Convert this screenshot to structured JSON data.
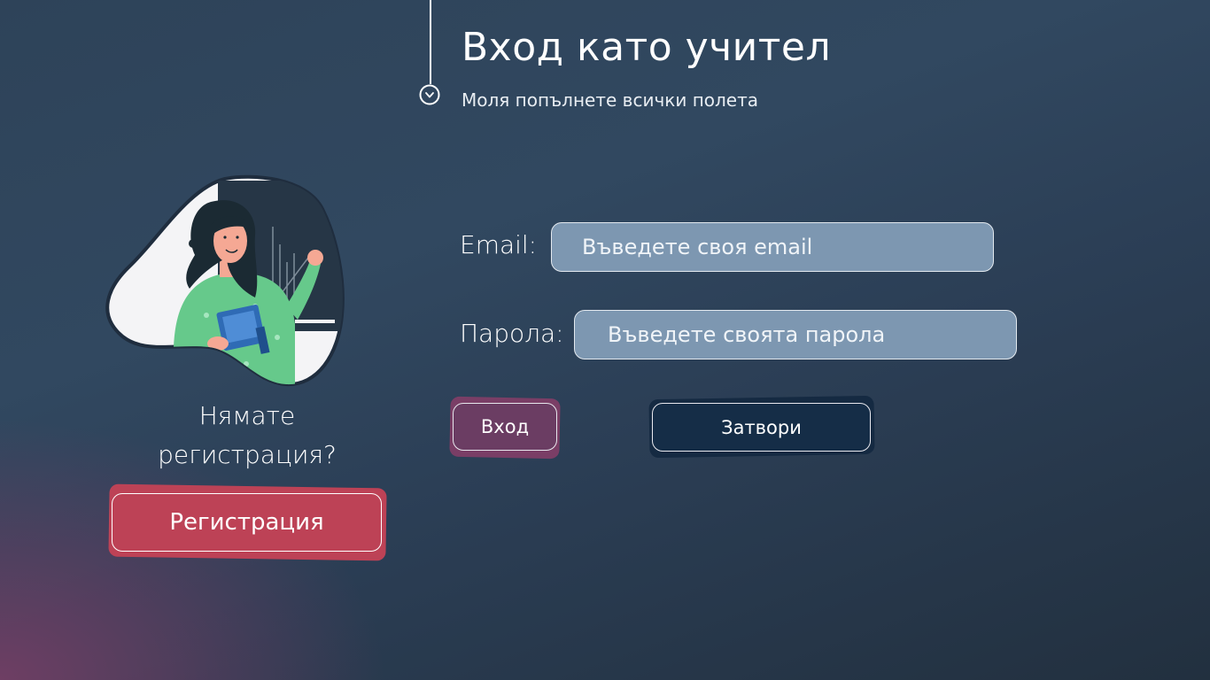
{
  "header": {
    "title": "Вход като учител",
    "subtitle": "Моля попълнете всички полета"
  },
  "illustration": {
    "icon": "teacher-illustration"
  },
  "register": {
    "question": "Нямате регистрация?",
    "button_label": "Регистрация"
  },
  "form": {
    "email_label": "Email:",
    "email_placeholder": "Въведете своя email",
    "email_value": "",
    "password_label": "Парола:",
    "password_placeholder": "Въведете своята парола",
    "password_value": ""
  },
  "actions": {
    "login_label": "Вход",
    "close_label": "Затвори"
  },
  "colors": {
    "register_button": "#bd4256",
    "login_button": "#6b3d63",
    "close_button": "#152d47",
    "input_fill": "#7d97b1"
  }
}
